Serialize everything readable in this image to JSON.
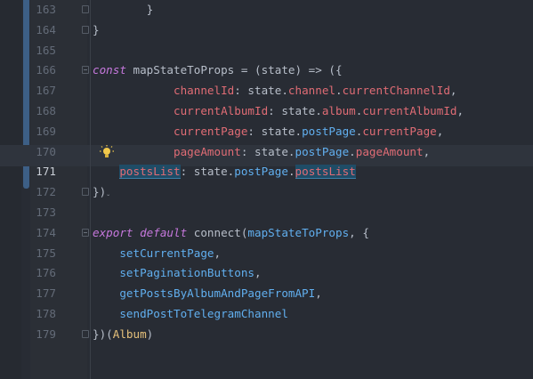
{
  "editor": {
    "language": "javascript",
    "active_line": 171,
    "lines": [
      {
        "num": "163",
        "tokens": [
          {
            "t": "        }",
            "c": "plain"
          }
        ]
      },
      {
        "num": "164",
        "tokens": [
          {
            "t": "}",
            "c": "plain"
          }
        ]
      },
      {
        "num": "165",
        "tokens": []
      },
      {
        "num": "166",
        "tokens": [
          {
            "t": "const",
            "c": "kw"
          },
          {
            "t": " ",
            "c": "plain"
          },
          {
            "t": "mapStateToProps",
            "c": "plain"
          },
          {
            "t": " = (state) => ({",
            "c": "plain"
          }
        ]
      },
      {
        "num": "167",
        "tokens": [
          {
            "t": "            ",
            "c": "plain"
          },
          {
            "t": "channelId",
            "c": "prop"
          },
          {
            "t": ": state.",
            "c": "plain"
          },
          {
            "t": "channel",
            "c": "prop"
          },
          {
            "t": ".",
            "c": "plain"
          },
          {
            "t": "currentChannelId",
            "c": "prop"
          },
          {
            "t": ",",
            "c": "plain"
          }
        ]
      },
      {
        "num": "168",
        "tokens": [
          {
            "t": "            ",
            "c": "plain"
          },
          {
            "t": "currentAlbumId",
            "c": "prop"
          },
          {
            "t": ": state.",
            "c": "plain"
          },
          {
            "t": "album",
            "c": "prop"
          },
          {
            "t": ".",
            "c": "plain"
          },
          {
            "t": "currentAlbumId",
            "c": "prop"
          },
          {
            "t": ",",
            "c": "plain"
          }
        ]
      },
      {
        "num": "169",
        "tokens": [
          {
            "t": "            ",
            "c": "plain"
          },
          {
            "t": "currentPage",
            "c": "prop"
          },
          {
            "t": ": state.",
            "c": "plain"
          },
          {
            "t": "postPage",
            "c": "fn"
          },
          {
            "t": ".",
            "c": "plain"
          },
          {
            "t": "currentPage",
            "c": "prop"
          },
          {
            "t": ",",
            "c": "plain"
          }
        ]
      },
      {
        "num": "170",
        "tokens": [
          {
            "t": "            ",
            "c": "plain"
          },
          {
            "t": "pageAmount",
            "c": "prop"
          },
          {
            "t": ": state.",
            "c": "plain"
          },
          {
            "t": "postPage",
            "c": "fn"
          },
          {
            "t": ".",
            "c": "plain"
          },
          {
            "t": "pageAmount",
            "c": "prop"
          },
          {
            "t": ",",
            "c": "plain"
          }
        ]
      },
      {
        "num": "171",
        "tokens": [
          {
            "t": "    ",
            "c": "plain"
          },
          {
            "t": "postsList",
            "c": "prop",
            "hl": true
          },
          {
            "t": ": state.",
            "c": "plain"
          },
          {
            "t": "postPage",
            "c": "fn"
          },
          {
            "t": ".",
            "c": "plain"
          },
          {
            "t": "postsList",
            "c": "prop",
            "hl": true
          }
        ]
      },
      {
        "num": "172",
        "tokens": [
          {
            "t": "})",
            "c": "plain"
          }
        ]
      },
      {
        "num": "173",
        "tokens": []
      },
      {
        "num": "174",
        "tokens": [
          {
            "t": "export",
            "c": "kw"
          },
          {
            "t": " ",
            "c": "plain"
          },
          {
            "t": "default",
            "c": "kw"
          },
          {
            "t": " connect(",
            "c": "plain"
          },
          {
            "t": "mapStateToProps",
            "c": "fn"
          },
          {
            "t": ", {",
            "c": "plain"
          }
        ]
      },
      {
        "num": "175",
        "tokens": [
          {
            "t": "    ",
            "c": "plain"
          },
          {
            "t": "setCurrentPage",
            "c": "fn"
          },
          {
            "t": ",",
            "c": "plain"
          }
        ]
      },
      {
        "num": "176",
        "tokens": [
          {
            "t": "    ",
            "c": "plain"
          },
          {
            "t": "setPaginationButtons",
            "c": "fn"
          },
          {
            "t": ",",
            "c": "plain"
          }
        ]
      },
      {
        "num": "177",
        "tokens": [
          {
            "t": "    ",
            "c": "plain"
          },
          {
            "t": "getPostsByAlbumAndPageFromAPI",
            "c": "fn"
          },
          {
            "t": ",",
            "c": "plain"
          }
        ]
      },
      {
        "num": "178",
        "tokens": [
          {
            "t": "    ",
            "c": "plain"
          },
          {
            "t": "sendPostToTelegramChannel",
            "c": "fn"
          }
        ]
      },
      {
        "num": "179",
        "tokens": [
          {
            "t": "})(",
            "c": "plain"
          },
          {
            "t": "Album",
            "c": "cls"
          },
          {
            "t": ")",
            "c": "plain"
          }
        ]
      }
    ],
    "fold_markers": {
      "163": "close",
      "164": "close",
      "166": "open",
      "172": "close",
      "174": "open",
      "179": "close"
    },
    "intention_bulb_line": "170",
    "squiggle_line": "172",
    "colors": {
      "background": "#282c34",
      "keyword": "#c678dd",
      "function": "#61afef",
      "property": "#e06c75",
      "class": "#e5c07b",
      "text": "#b7bec9",
      "line_number": "#636b78",
      "highlight": "#1f4c66"
    },
    "icons": {
      "bulb": "lightbulb-icon",
      "fold": "fold-marker-icon"
    }
  }
}
